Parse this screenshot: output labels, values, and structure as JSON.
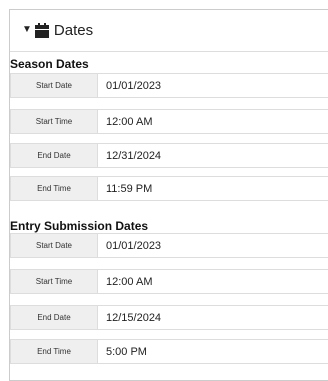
{
  "panel": {
    "title": "Dates",
    "expanded": true,
    "icon": "calendar-icon"
  },
  "season": {
    "title": "Season Dates",
    "rows": [
      {
        "label": "Start Date",
        "value": "01/01/2023"
      },
      {
        "label": "Start Time",
        "value": "12:00 AM"
      },
      {
        "label": "End Date",
        "value": "12/31/2024"
      },
      {
        "label": "End Time",
        "value": "11:59 PM"
      }
    ]
  },
  "entry": {
    "title": "Entry Submission Dates",
    "rows": [
      {
        "label": "Start Date",
        "value": "01/01/2023"
      },
      {
        "label": "Start Time",
        "value": "12:00 AM"
      },
      {
        "label": "End Date",
        "value": "12/15/2024"
      },
      {
        "label": "End Time",
        "value": "5:00 PM"
      }
    ]
  }
}
